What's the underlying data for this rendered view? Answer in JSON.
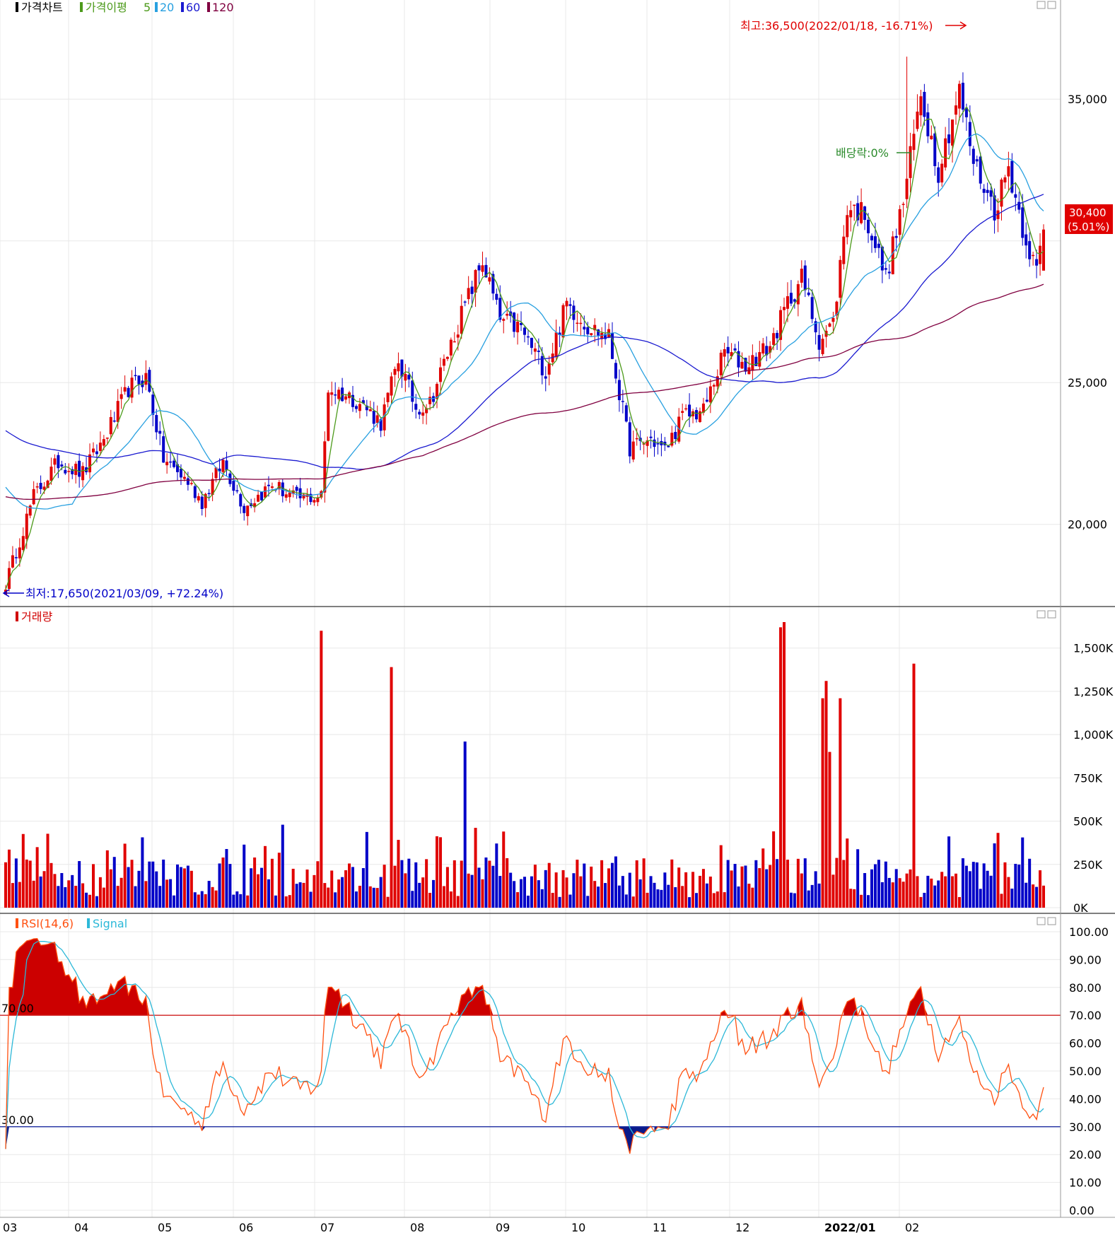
{
  "legend": {
    "price": [
      {
        "text": "가격차트",
        "color": "#000000"
      },
      {
        "text": "가격이평",
        "color": "#4c9a1a"
      },
      {
        "text": "5",
        "color": "#4c9a1a"
      },
      {
        "text": "20",
        "color": "#28a0e0"
      },
      {
        "text": "60",
        "color": "#1a1ad0"
      },
      {
        "text": "120",
        "color": "#800040"
      }
    ],
    "volume": {
      "text": "거래량",
      "color": "#d00000"
    },
    "rsi": [
      {
        "text": "RSI(14,6)",
        "color": "#ff5010"
      },
      {
        "text": "Signal",
        "color": "#2cb8d8"
      }
    ]
  },
  "annotations": {
    "high": "최고:36,500(2022/01/18, -16.71%)",
    "low": "최저:17,650(2021/03/09, +72.24%)",
    "dividend": "배당락:0%",
    "current_price": "30,400",
    "current_change": "(5.01%)"
  },
  "colors": {
    "up": "#e00000",
    "down": "#0000c8",
    "ma5": "#4c9a1a",
    "ma20": "#28a0e0",
    "ma60": "#1a1ad0",
    "ma120": "#800040",
    "rsi": "#ff5010",
    "signal": "#2cb8d8",
    "grid": "#e8e8e8"
  },
  "chart_data": [
    {
      "type": "candlestick",
      "title": "가격차트",
      "y_ticks": [
        "20,000",
        "25,000",
        "35,000"
      ],
      "ylim": [
        17300,
        37500
      ],
      "x_ticks": [
        "03",
        "04",
        "05",
        "06",
        "07",
        "08",
        "09",
        "10",
        "11",
        "12",
        "2022/01",
        "02"
      ],
      "anchors": [
        {
          "i": 0,
          "v": 17900
        },
        {
          "i": 8,
          "v": 21000
        },
        {
          "i": 15,
          "v": 22200
        },
        {
          "i": 22,
          "v": 21800
        },
        {
          "i": 28,
          "v": 23000
        },
        {
          "i": 35,
          "v": 24800
        },
        {
          "i": 40,
          "v": 25200
        },
        {
          "i": 45,
          "v": 22300
        },
        {
          "i": 52,
          "v": 21500
        },
        {
          "i": 56,
          "v": 20800
        },
        {
          "i": 62,
          "v": 22200
        },
        {
          "i": 68,
          "v": 20600
        },
        {
          "i": 76,
          "v": 21400
        },
        {
          "i": 83,
          "v": 20900
        },
        {
          "i": 90,
          "v": 21000
        },
        {
          "i": 92,
          "v": 24800
        },
        {
          "i": 100,
          "v": 24400
        },
        {
          "i": 107,
          "v": 23600
        },
        {
          "i": 112,
          "v": 25800
        },
        {
          "i": 117,
          "v": 24100
        },
        {
          "i": 121,
          "v": 24300
        },
        {
          "i": 130,
          "v": 27400
        },
        {
          "i": 136,
          "v": 29300
        },
        {
          "i": 141,
          "v": 27200
        },
        {
          "i": 147,
          "v": 26900
        },
        {
          "i": 154,
          "v": 25400
        },
        {
          "i": 160,
          "v": 27800
        },
        {
          "i": 166,
          "v": 27000
        },
        {
          "i": 172,
          "v": 26600
        },
        {
          "i": 178,
          "v": 22700
        },
        {
          "i": 184,
          "v": 23000
        },
        {
          "i": 188,
          "v": 22600
        },
        {
          "i": 193,
          "v": 23800
        },
        {
          "i": 199,
          "v": 24000
        },
        {
          "i": 205,
          "v": 26100
        },
        {
          "i": 211,
          "v": 25600
        },
        {
          "i": 218,
          "v": 26300
        },
        {
          "i": 223,
          "v": 27800
        },
        {
          "i": 227,
          "v": 28700
        },
        {
          "i": 232,
          "v": 26500
        },
        {
          "i": 236,
          "v": 27100
        },
        {
          "i": 240,
          "v": 31200
        },
        {
          "i": 245,
          "v": 31000
        },
        {
          "i": 251,
          "v": 28700
        },
        {
          "i": 256,
          "v": 31400
        },
        {
          "i": 261,
          "v": 35200
        },
        {
          "i": 266,
          "v": 32500
        },
        {
          "i": 272,
          "v": 35300
        },
        {
          "i": 276,
          "v": 32800
        },
        {
          "i": 282,
          "v": 31100
        },
        {
          "i": 286,
          "v": 32600
        },
        {
          "i": 290,
          "v": 30500
        },
        {
          "i": 294,
          "v": 28900
        },
        {
          "i": 296,
          "v": 30400
        }
      ],
      "max": {
        "value": 36500,
        "date": "2022/01/18"
      },
      "min": {
        "value": 17650,
        "date": "2021/03/09"
      },
      "last": {
        "close": 30400,
        "change_pct": 5.01
      }
    },
    {
      "type": "bar",
      "title": "거래량",
      "y_ticks": [
        "0K",
        "250K",
        "500K",
        "750K",
        "1,000K",
        "1,250K",
        "1,500K"
      ],
      "ylim": [
        0,
        1650000
      ],
      "spikes": [
        {
          "i": 90,
          "v": 1600000
        },
        {
          "i": 110,
          "v": 1390000
        },
        {
          "i": 131,
          "v": 960000
        },
        {
          "i": 221,
          "v": 1620000
        },
        {
          "i": 222,
          "v": 1650000
        },
        {
          "i": 233,
          "v": 1210000
        },
        {
          "i": 234,
          "v": 1310000
        },
        {
          "i": 235,
          "v": 900000
        },
        {
          "i": 238,
          "v": 1210000
        },
        {
          "i": 259,
          "v": 1410000
        }
      ]
    },
    {
      "type": "line",
      "title": "RSI(14,6)",
      "series": [
        {
          "name": "RSI(14,6)"
        },
        {
          "name": "Signal"
        }
      ],
      "y_ticks": [
        "0.00",
        "10.00",
        "20.00",
        "30.00",
        "40.00",
        "50.00",
        "60.00",
        "70.00",
        "80.00",
        "90.00",
        "100.00"
      ],
      "ylim": [
        0,
        100
      ],
      "levels": [
        {
          "value": 70,
          "label": "70.00"
        },
        {
          "value": 30,
          "label": "30.00"
        }
      ]
    }
  ]
}
